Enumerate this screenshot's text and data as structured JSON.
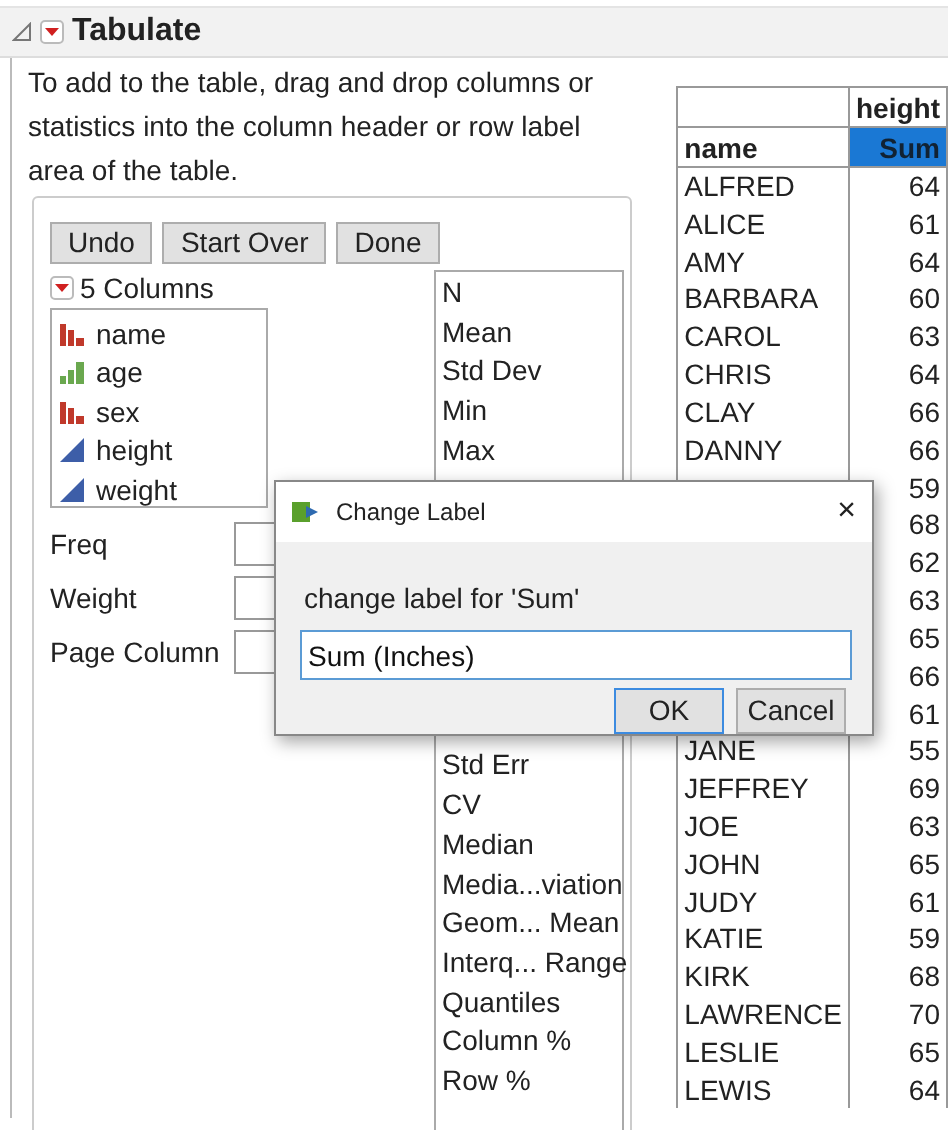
{
  "header": {
    "title": "Tabulate",
    "expanded": true
  },
  "instructions": "To add to the table, drag and drop columns or statistics into the column header or row label area of the table.",
  "buttons": [
    "Undo",
    "Start Over",
    "Done"
  ],
  "columns_list": {
    "title": "5 Columns",
    "items": [
      {
        "name": "name",
        "kind": "nominal"
      },
      {
        "name": "age",
        "kind": "ordinal"
      },
      {
        "name": "sex",
        "kind": "nominal"
      },
      {
        "name": "height",
        "kind": "continuous"
      },
      {
        "name": "weight",
        "kind": "continuous"
      }
    ]
  },
  "roles": [
    "Freq",
    "Weight",
    "Page Column"
  ],
  "statistics_above": [
    "N",
    "Mean",
    "Std Dev",
    "Min",
    "Max"
  ],
  "statistics_below": [
    "Std Err",
    "CV",
    "Median",
    "Media...viation",
    "Geom... Mean",
    "Interq... Range",
    "Quantiles",
    "Column %",
    "Row %"
  ],
  "table": {
    "column_group": "height",
    "row_header": "name",
    "statistic": {
      "label": "Sum",
      "selected": true
    },
    "rows": [
      {
        "name": "ALFRED",
        "value": "64"
      },
      {
        "name": "ALICE",
        "value": "61"
      },
      {
        "name": "AMY",
        "value": "64"
      },
      {
        "name": "BARBARA",
        "value": "60"
      },
      {
        "name": "CAROL",
        "value": "63"
      },
      {
        "name": "CHRIS",
        "value": "64"
      },
      {
        "name": "CLAY",
        "value": "66"
      },
      {
        "name": "DANNY",
        "value": "66"
      },
      {
        "value": "59"
      },
      {
        "value": "68"
      },
      {
        "value": "62"
      },
      {
        "value": "63"
      },
      {
        "value": "65"
      },
      {
        "value": "66"
      },
      {
        "value": "61"
      },
      {
        "name": "JANE",
        "value": "55"
      },
      {
        "name": "JEFFREY",
        "value": "69"
      },
      {
        "name": "JOE",
        "value": "63"
      },
      {
        "name": "JOHN",
        "value": "65"
      },
      {
        "name": "JUDY",
        "value": "61"
      },
      {
        "name": "KATIE",
        "value": "59"
      },
      {
        "name": "KIRK",
        "value": "68"
      },
      {
        "name": "LAWRENCE",
        "value": "70"
      },
      {
        "name": "LESLIE",
        "value": "65"
      },
      {
        "name": "LEWIS",
        "value": "64"
      }
    ]
  },
  "dialog": {
    "title": "Change Label",
    "prompt": "change label for 'Sum'",
    "value": "Sum (Inches)",
    "buttons": [
      "OK",
      "Cancel"
    ],
    "close": "×"
  }
}
